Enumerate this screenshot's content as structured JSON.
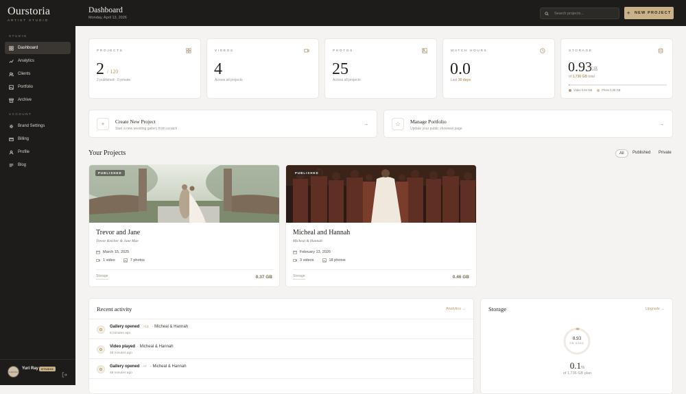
{
  "brand": {
    "name": "Ourstoria",
    "tagline": "ARTIST STUDIO"
  },
  "sidebar": {
    "sections": [
      {
        "label": "STUDIO",
        "items": [
          {
            "label": "Dashboard",
            "icon": "grid-icon",
            "active": true
          },
          {
            "label": "Analytics",
            "icon": "trend-icon"
          },
          {
            "label": "Clients",
            "icon": "users-icon"
          },
          {
            "label": "Portfolio",
            "icon": "image-icon"
          },
          {
            "label": "Archive",
            "icon": "archive-icon"
          }
        ]
      },
      {
        "label": "ACCOUNT",
        "items": [
          {
            "label": "Brand Settings",
            "icon": "gear-icon"
          },
          {
            "label": "Billing",
            "icon": "card-icon"
          },
          {
            "label": "Profile",
            "icon": "user-icon"
          },
          {
            "label": "Blog",
            "icon": "lines-icon"
          }
        ]
      }
    ],
    "user": {
      "name": "Yuri Ray",
      "plan": "STUDIO",
      "avatar_text": "YURI RAY"
    }
  },
  "header": {
    "title": "Dashboard",
    "date": "Monday, April 13, 2026",
    "search_placeholder": "Search projects...",
    "new_project": "NEW PROJECT"
  },
  "stats": {
    "projects": {
      "label": "PROJECTS",
      "value": "2",
      "of": "/ 120",
      "sub": "2 published · 0 private"
    },
    "videos": {
      "label": "VIDEOS",
      "value": "4",
      "sub": "Across all projects"
    },
    "photos": {
      "label": "PHOTOS",
      "value": "25",
      "sub": "Across all projects"
    },
    "watch": {
      "label": "WATCH HOURS",
      "value": "0.0",
      "sub_prefix": "Last",
      "sub_strong": "30 days"
    },
    "storage": {
      "label": "STORAGE",
      "value": "0.93",
      "unit": "GB",
      "sub_prefix": "of",
      "sub_strong": "1,736 GB",
      "sub_suffix": "total",
      "used_fraction": 0.0005,
      "video_label": "Video 0.84 GB",
      "photo_label": "Photo 0.09 GB",
      "video_color": "#b99c63",
      "photo_color": "#d9c29a"
    }
  },
  "actions": [
    {
      "icon": "+",
      "title": "Create New Project",
      "sub": "Start a new wedding gallery from scratch",
      "arrow": "→"
    },
    {
      "icon": "☆",
      "title": "Manage Portfolio",
      "sub": "Update your public showreel page",
      "arrow": "→"
    }
  ],
  "projects_section": {
    "title": "Your Projects",
    "filters": [
      "All",
      "Published",
      "Private"
    ]
  },
  "projects": [
    {
      "badge": "PUBLISHED",
      "title": "Trevor and Jane",
      "subtitle": "Trevor Kelcher & Jane Mae",
      "date": "March 15, 2025",
      "videos": "1 video",
      "photos": "7 photos",
      "storage_label": "Storage",
      "storage": "0.37 GB"
    },
    {
      "badge": "PUBLISHED",
      "title": "Micheal and Hannah",
      "subtitle": "Micheal & Hannah",
      "date": "February 13, 2026",
      "videos": "3 videos",
      "photos": "18 photos",
      "storage_label": "Storage",
      "storage": "0.46 GB"
    }
  ],
  "activity": {
    "title": "Recent activity",
    "link": "Analytics →",
    "items": [
      {
        "action": "Gallery opened",
        "badge": "×13",
        "project": "· Micheal & Hannah",
        "time": "8 minutes ago"
      },
      {
        "action": "Video played",
        "badge": "",
        "project": "· Micheal & Hannah",
        "time": "48 minutes ago"
      },
      {
        "action": "Gallery opened",
        "badge": "×7",
        "project": "· Micheal & Hannah",
        "time": "48 minutes ago"
      }
    ]
  },
  "storage_panel": {
    "title": "Storage",
    "link": "Upgrade →",
    "ring_value": "0.93",
    "ring_sub": "GB USED",
    "percent": "0.1",
    "percent_unit": "%",
    "plan": "of 1,736 GB plan",
    "ring_color": "#c9b28a"
  }
}
